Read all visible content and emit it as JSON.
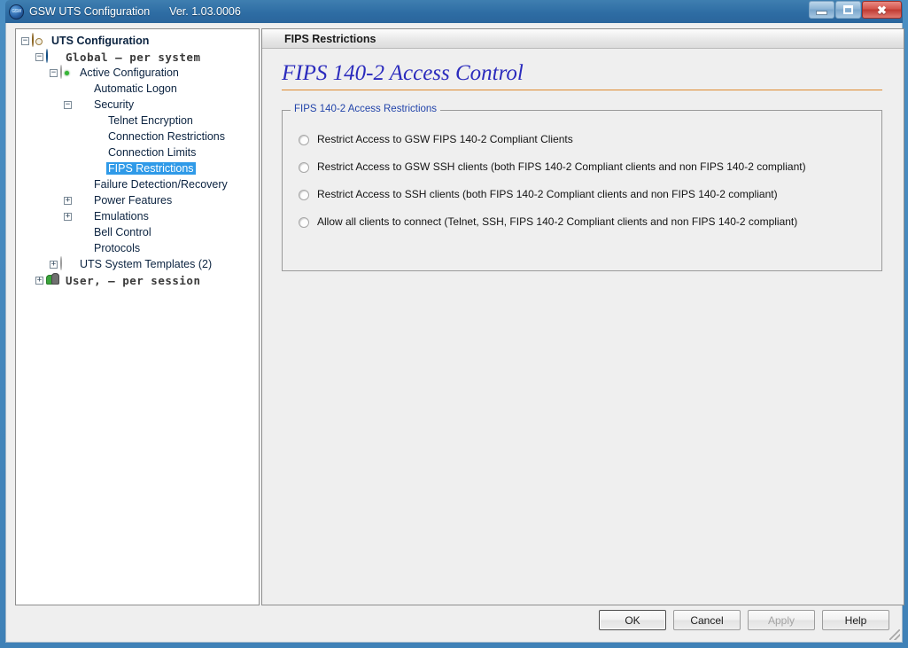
{
  "window": {
    "title": "GSW UTS Configuration",
    "version": "Ver. 1.03.0006",
    "app_icon": "gsw-logo-icon",
    "controls": {
      "minimize": "minimize-icon",
      "maximize": "maximize-icon",
      "close": "close-icon"
    }
  },
  "tree": {
    "items": [
      {
        "label": "UTS Configuration",
        "indent": 0,
        "toggle": "minus",
        "icon": "gear-orange-icon",
        "style": "bold",
        "selected": false
      },
      {
        "label": "Global  –  per system",
        "indent": 1,
        "toggle": "minus",
        "icon": "globe-icon",
        "style": "mono",
        "selected": false
      },
      {
        "label": "Active Configuration",
        "indent": 2,
        "toggle": "minus",
        "icon": "gear-active-icon",
        "style": "normal",
        "selected": false
      },
      {
        "label": "Automatic Logon",
        "indent": 3,
        "toggle": "none",
        "icon": "gear-dark-icon",
        "style": "normal",
        "selected": false
      },
      {
        "label": "Security",
        "indent": 3,
        "toggle": "minus",
        "icon": "gear-dark-icon",
        "style": "normal",
        "selected": false
      },
      {
        "label": "Telnet Encryption",
        "indent": 4,
        "toggle": "none",
        "icon": "gear-dark-icon",
        "style": "normal",
        "selected": false
      },
      {
        "label": "Connection Restrictions",
        "indent": 4,
        "toggle": "none",
        "icon": "gear-dark-icon",
        "style": "normal",
        "selected": false
      },
      {
        "label": "Connection Limits",
        "indent": 4,
        "toggle": "none",
        "icon": "gear-dark-icon",
        "style": "normal",
        "selected": false
      },
      {
        "label": "FIPS Restrictions",
        "indent": 4,
        "toggle": "none",
        "icon": "gear-dark-icon",
        "style": "normal",
        "selected": true
      },
      {
        "label": "Failure Detection/Recovery",
        "indent": 3,
        "toggle": "none",
        "icon": "gear-dark-icon",
        "style": "normal",
        "selected": false
      },
      {
        "label": "Power Features",
        "indent": 3,
        "toggle": "plus",
        "icon": "gear-dark-icon",
        "style": "normal",
        "selected": false
      },
      {
        "label": "Emulations",
        "indent": 3,
        "toggle": "plus",
        "icon": "gear-dark-icon",
        "style": "normal",
        "selected": false
      },
      {
        "label": "Bell Control",
        "indent": 3,
        "toggle": "none",
        "icon": "gear-dark-icon",
        "style": "normal",
        "selected": false
      },
      {
        "label": "Protocols",
        "indent": 3,
        "toggle": "none",
        "icon": "gear-dark-icon",
        "style": "normal",
        "selected": false
      },
      {
        "label": "UTS System Templates (2)",
        "indent": 2,
        "toggle": "plus",
        "icon": "gear-grey-icon",
        "style": "normal",
        "selected": false
      },
      {
        "label": "User,   –  per session",
        "indent": 1,
        "toggle": "plus",
        "icon": "users-icon",
        "style": "mono",
        "selected": false
      }
    ]
  },
  "panel": {
    "header_icon": "gear-dark-icon",
    "header_title": "FIPS Restrictions",
    "page_title": "FIPS 140-2 Access Control",
    "accent_rule_color": "#e08a2e",
    "title_color": "#2b2bbd",
    "groupbox": {
      "legend": "FIPS 140-2 Access Restrictions",
      "legend_color": "#2244aa",
      "options": [
        {
          "label": "Restrict Access to GSW FIPS 140-2 Compliant Clients",
          "selected": false
        },
        {
          "label": "Restrict Access to GSW SSH clients (both FIPS 140-2 Compliant clients and non FIPS 140-2 compliant)",
          "selected": false
        },
        {
          "label": "Restrict Access to SSH clients (both FIPS 140-2 Compliant clients and non FIPS 140-2 compliant)",
          "selected": false
        },
        {
          "label": "Allow all clients to connect (Telnet, SSH, FIPS 140-2 Compliant clients and non FIPS 140-2 compliant)",
          "selected": false
        }
      ]
    }
  },
  "footer": {
    "buttons": [
      {
        "label": "OK",
        "state": "default"
      },
      {
        "label": "Cancel",
        "state": "normal"
      },
      {
        "label": "Apply",
        "state": "disabled"
      },
      {
        "label": "Help",
        "state": "normal"
      }
    ]
  }
}
